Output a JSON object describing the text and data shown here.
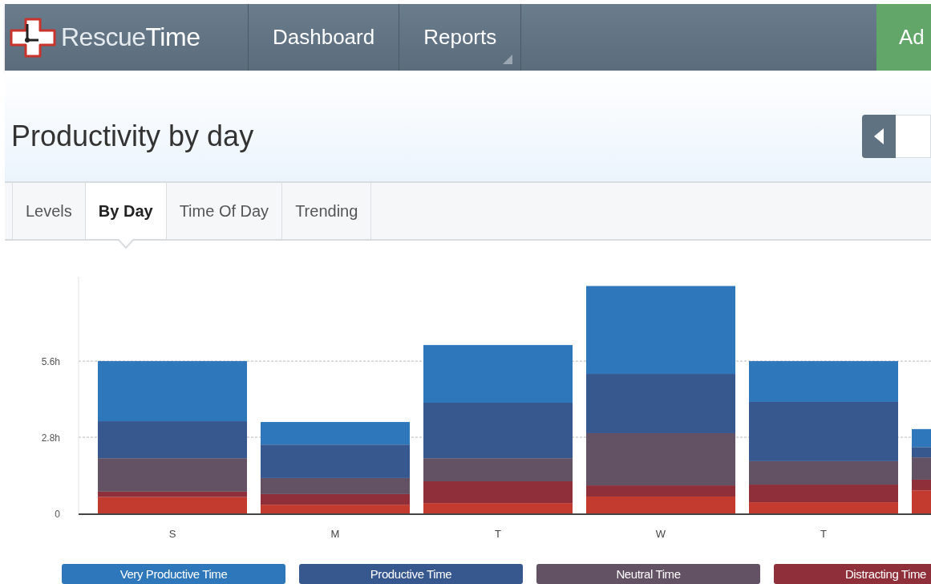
{
  "nav": {
    "logo": {
      "light": "Rescue",
      "bold": "Time"
    },
    "items": [
      {
        "label": "Dashboard",
        "dropdown": false
      },
      {
        "label": "Reports",
        "dropdown": true
      }
    ],
    "action": "Ad"
  },
  "header": {
    "title": "Productivity by day"
  },
  "tabs": [
    {
      "label": "Levels",
      "selected": false
    },
    {
      "label": "By Day",
      "selected": true
    },
    {
      "label": "Time Of Day",
      "selected": false
    },
    {
      "label": "Trending",
      "selected": false
    }
  ],
  "chart": {
    "chart_data": {
      "type": "bar",
      "stacked": true,
      "categories": [
        "S",
        "M",
        "T",
        "W",
        "T",
        null
      ],
      "ylim": [
        0,
        8.7
      ],
      "yticks": [
        {
          "value": 0,
          "label": "0"
        },
        {
          "value": 2.8,
          "label": "2.8h"
        },
        {
          "value": 5.6,
          "label": "5.6h"
        }
      ],
      "series": [
        {
          "color": "#c33a2f",
          "values": [
            0.6,
            0.32,
            0.38,
            0.62,
            0.41,
            0.85
          ]
        },
        {
          "name": "Distracting Time",
          "color": "#8e2f3a",
          "values": [
            0.2,
            0.39,
            0.8,
            0.41,
            0.65,
            0.39
          ]
        },
        {
          "name": "Neutral Time",
          "color": "#625264",
          "values": [
            1.23,
            0.59,
            0.85,
            1.92,
            0.86,
            0.82
          ]
        },
        {
          "name": "Productive Time",
          "color": "#37588f",
          "values": [
            1.36,
            1.23,
            2.04,
            2.18,
            2.18,
            0.38
          ]
        },
        {
          "name": "Very Productive Time",
          "color": "#2e77bb",
          "values": [
            2.21,
            0.83,
            2.12,
            3.23,
            1.5,
            0.66
          ]
        }
      ]
    }
  }
}
